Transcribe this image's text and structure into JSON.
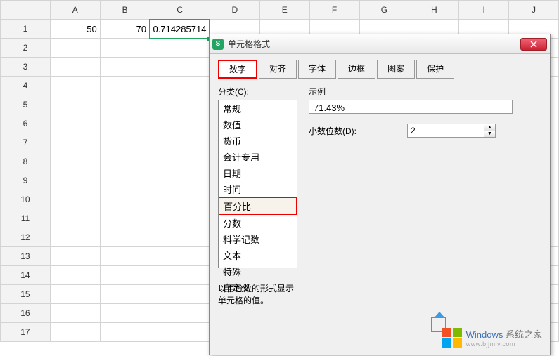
{
  "spreadsheet": {
    "columns": [
      "A",
      "B",
      "C",
      "D",
      "E",
      "F",
      "G",
      "H",
      "I",
      "J"
    ],
    "row_count": 17,
    "cells": {
      "A1": "50",
      "B1": "70",
      "C1": "0.714285714"
    },
    "active_cell": "C1"
  },
  "dialog": {
    "title": "单元格格式",
    "tabs": [
      "数字",
      "对齐",
      "字体",
      "边框",
      "图案",
      "保护"
    ],
    "active_tab": "数字",
    "category_label": "分类(C):",
    "categories": [
      "常规",
      "数值",
      "货币",
      "会计专用",
      "日期",
      "时间",
      "百分比",
      "分数",
      "科学记数",
      "文本",
      "特殊",
      "自定义"
    ],
    "selected_category": "百分比",
    "preview_label": "示例",
    "preview_value": "71.43%",
    "decimals_label": "小数位数(D):",
    "decimals_value": "2",
    "description": "以百分数的形式显示单元格的值。"
  },
  "watermark": {
    "brand1": "Windows",
    "brand1_cn": "系统之家",
    "url": "www.bjjmlv.com"
  }
}
